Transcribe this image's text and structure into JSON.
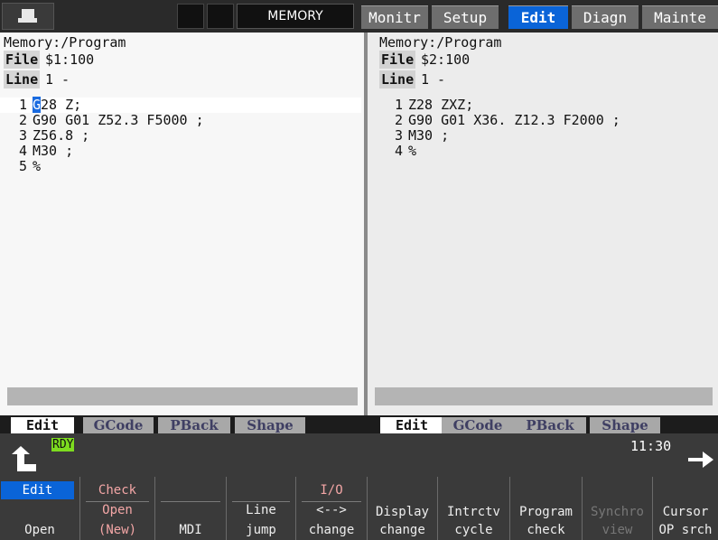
{
  "top_bar": {
    "mode": "MEMORY",
    "tabs": [
      {
        "label": "Monitr",
        "active": false
      },
      {
        "label": "Setup",
        "active": false
      },
      {
        "label": "Edit",
        "active": true
      },
      {
        "label": "Diagn",
        "active": false
      },
      {
        "label": "Mainte",
        "active": false
      }
    ]
  },
  "panes": [
    {
      "title": "Memory:/Program",
      "file_label": "File",
      "file_value": "$1:100",
      "line_label": "Line",
      "line_value": "1 -",
      "lines": [
        {
          "num": "1",
          "cursor_char": "G",
          "text": "28 Z;"
        },
        {
          "num": "2",
          "text": "G90 G01 Z52.3 F5000 ;"
        },
        {
          "num": "3",
          "text": "Z56.8 ;"
        },
        {
          "num": "4",
          "text": "M30 ;"
        },
        {
          "num": "5",
          "text": "%"
        }
      ],
      "subtabs": [
        "Edit",
        "GCode",
        "PBack",
        "Shape"
      ],
      "active_subtab": "Edit"
    },
    {
      "title": "Memory:/Program",
      "file_label": "File",
      "file_value": "$2:100",
      "line_label": "Line",
      "line_value": "1 -",
      "lines": [
        {
          "num": "1",
          "text": "Z28 ZXZ;"
        },
        {
          "num": "2",
          "text": "G90 G01 X36. Z12.3 F2000 ;"
        },
        {
          "num": "3",
          "text": "M30 ;"
        },
        {
          "num": "4",
          "text": "%"
        }
      ],
      "subtabs": [
        "Edit",
        "GCode",
        "PBack",
        "Shape"
      ],
      "active_subtab": "Edit"
    }
  ],
  "status": {
    "ready": "RDY",
    "time": "11:30"
  },
  "soft_keys": [
    {
      "header": "Edit",
      "main": "Open"
    },
    {
      "header": "Check",
      "main_line1": "Open",
      "main": "(New)"
    },
    {
      "header": "",
      "main": "MDI"
    },
    {
      "header": "",
      "main_line1": "Line",
      "main": "jump"
    },
    {
      "header": "I/O",
      "main_line1": "<-->",
      "main": "change"
    },
    {
      "header": "",
      "main_line1": "Display",
      "main": "change"
    },
    {
      "header": "",
      "main_line1": "Intrctv",
      "main": "cycle"
    },
    {
      "header": "",
      "main_line1": "Program",
      "main": "check"
    },
    {
      "header": "",
      "main_line1": "Synchro",
      "main": "view"
    },
    {
      "header": "",
      "main_line1": "Cursor",
      "main": "OP srch"
    }
  ],
  "colors": {
    "accent_blue": "#0a64d8",
    "ready_green": "#7ddc1f",
    "pink_text": "#f3a6a6"
  }
}
